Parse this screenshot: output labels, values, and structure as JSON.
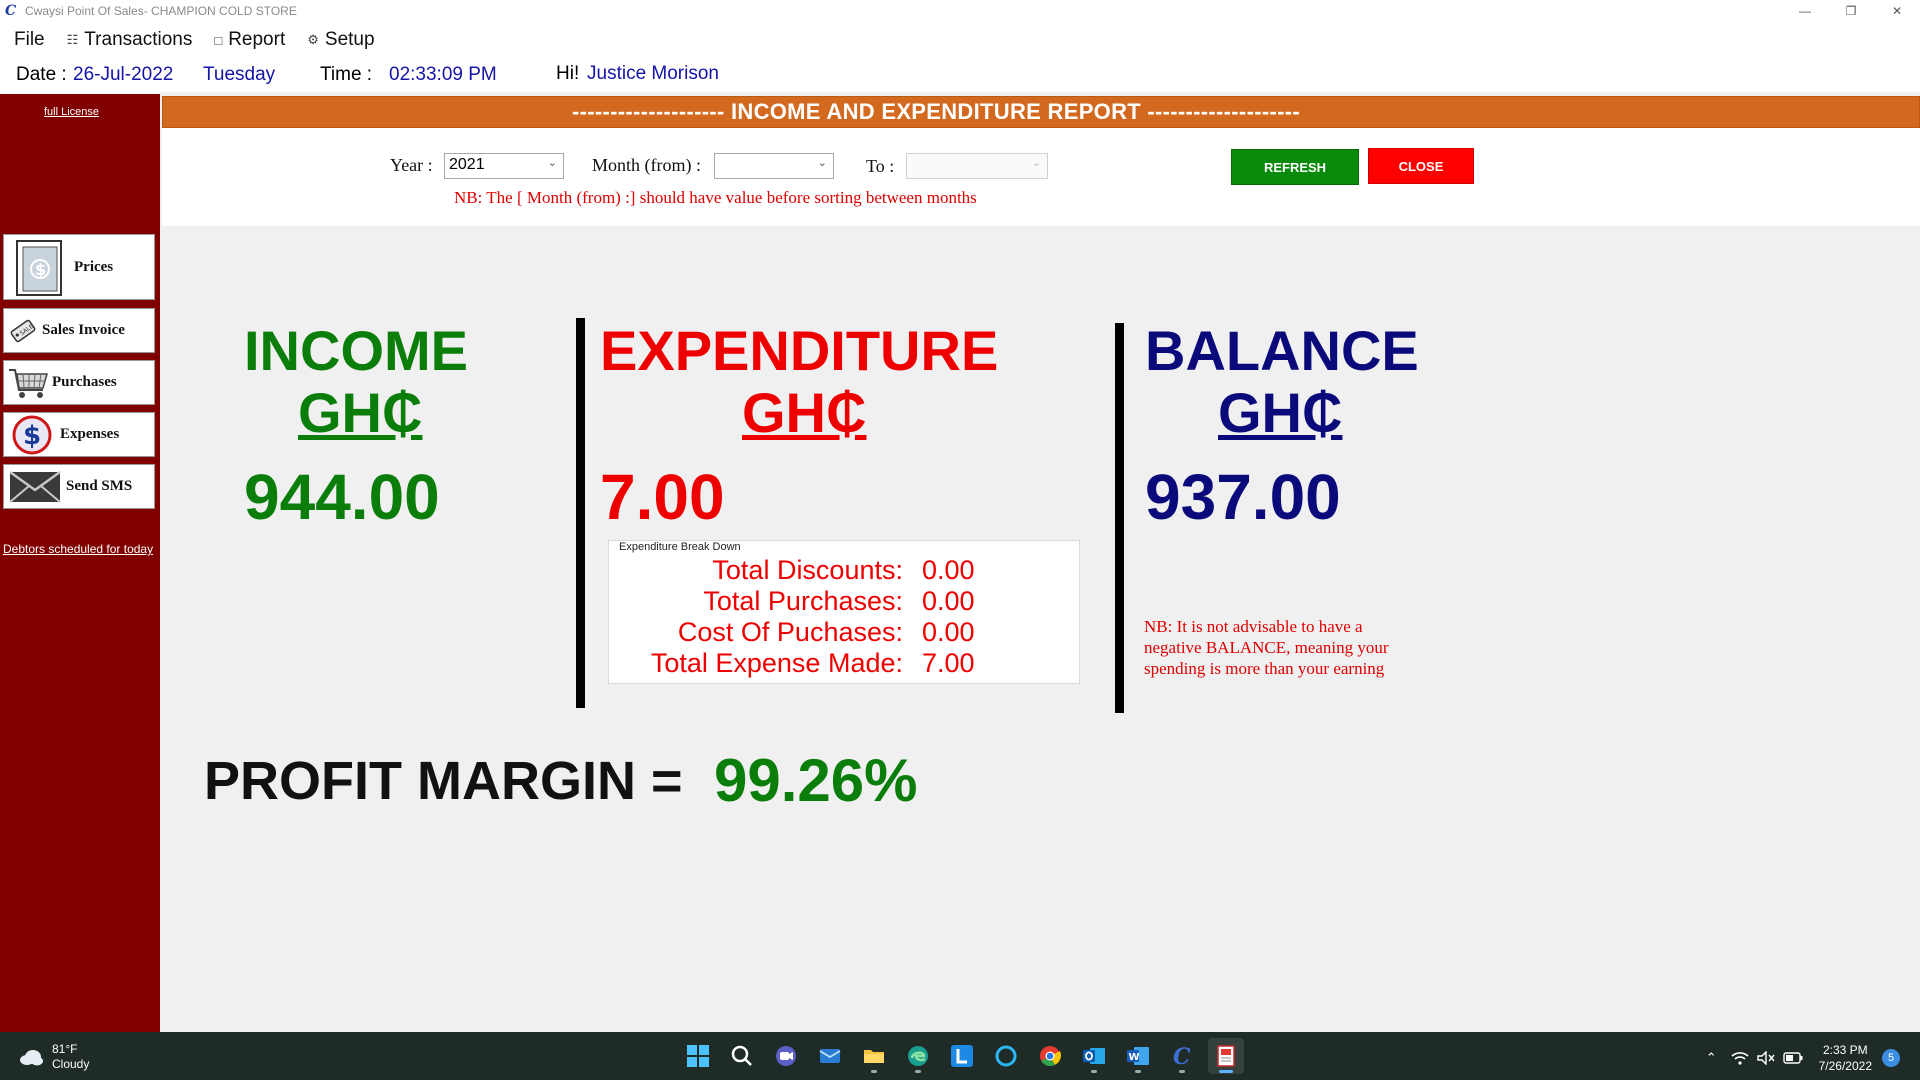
{
  "window": {
    "title": "Cwaysi Point Of Sales- CHAMPION COLD STORE",
    "minimize": "—",
    "restore": "❐",
    "close": "✕"
  },
  "menu": {
    "file": "File",
    "transactions": "Transactions",
    "report": "Report",
    "setup": "Setup"
  },
  "info": {
    "date_label": "Date :",
    "date_value": "26-Jul-2022",
    "day": "Tuesday",
    "time_label": "Time :",
    "time_value": "02:33:09 PM",
    "greeting": "Hi!",
    "user": "Justice Morison"
  },
  "sidebar": {
    "license_link": "full License",
    "items": [
      {
        "label": "Prices",
        "icon": "price-tag-icon"
      },
      {
        "label": "Sales Invoice",
        "icon": "sale-tag-icon"
      },
      {
        "label": "Purchases",
        "icon": "shopping-cart-icon"
      },
      {
        "label": "Expenses",
        "icon": "dollar-circle-icon"
      },
      {
        "label": "Send SMS",
        "icon": "envelope-icon"
      }
    ],
    "debtors_link": "Debtors scheduled for today"
  },
  "report": {
    "title": "-------------------- INCOME AND EXPENDITURE REPORT --------------------",
    "year_label": "Year :",
    "year_value": "2021",
    "month_from_label": "Month (from) :",
    "month_from_value": "",
    "to_label": "To :",
    "to_value": "",
    "refresh_label": "REFRESH",
    "close_label": "CLOSE",
    "note": "NB: The [ Month (from) :] should have value before sorting between months"
  },
  "summary": {
    "income_label": "INCOME",
    "income_currency": "GH₵",
    "income_value": "944.00",
    "expenditure_label": "EXPENDITURE",
    "expenditure_currency": "GH₵",
    "expenditure_value": "7.00",
    "balance_label": "BALANCE",
    "balance_currency": "GH₵",
    "balance_value": "937.00",
    "balance_note": "NB: It is not advisable to have a negative BALANCE, meaning your spending is more than your earning"
  },
  "breakdown": {
    "title": "Expenditure Break Down",
    "rows": [
      {
        "label": "Total Discounts:",
        "value": "0.00"
      },
      {
        "label": "Total Purchases:",
        "value": "0.00"
      },
      {
        "label": "Cost Of Puchases:",
        "value": "0.00"
      },
      {
        "label": "Total Expense Made:",
        "value": "7.00"
      }
    ]
  },
  "profit": {
    "label": "PROFIT MARGIN =",
    "value": "99.26%"
  },
  "taskbar": {
    "temperature": "81°F",
    "condition": "Cloudy",
    "time": "2:33 PM",
    "date": "7/26/2022",
    "notifications": "5",
    "apps": [
      "start-icon",
      "search-icon",
      "meet-icon",
      "mail-icon",
      "file-explorer-icon",
      "edge-icon",
      "launcher-icon",
      "cortana-icon",
      "chrome-icon",
      "outlook-icon",
      "word-icon",
      "pos-app-icon",
      "pos-report-icon"
    ]
  },
  "colors": {
    "sidebar": "#800000",
    "header": "#d2691e",
    "income": "#0a7d0a",
    "expenditure": "#ee0000",
    "balance": "#0a0a7a"
  }
}
